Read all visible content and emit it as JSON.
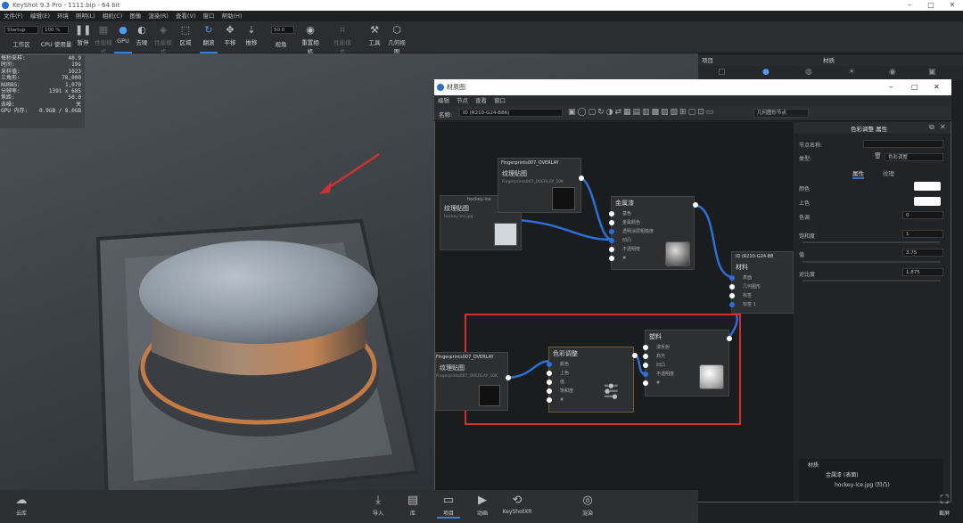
{
  "window": {
    "title": "KeyShot 9.3 Pro - 1111.bip - 64 bit"
  },
  "menubar": [
    "文件(F)",
    "编辑(E)",
    "环境",
    "照明(L)",
    "相机(C)",
    "图像",
    "渲染(R)",
    "查看(V)",
    "窗口",
    "帮助(H)"
  ],
  "toolbar": {
    "startup_value": "Startup",
    "percent_value": "100 %",
    "workspace": "工作区",
    "cpu_usage": "CPU 使用量",
    "pause": "暂停",
    "perf_mode": "性能模式",
    "gpu": "GPU",
    "denoise": "去噪",
    "region": "区域",
    "flip": "翻滚",
    "pan": "平移",
    "push": "推移",
    "fov_value": "50.0",
    "view_angle": "视角",
    "reset_camera": "重置相机",
    "tool": "工具",
    "geometry_view": "几何视图"
  },
  "stats": [
    {
      "k": "每秒采样:",
      "v": "40.9"
    },
    {
      "k": "时间:",
      "v": "19s"
    },
    {
      "k": "采样值:",
      "v": "1023"
    },
    {
      "k": "三角形:",
      "v": "78,000"
    },
    {
      "k": "NURBS:",
      "v": "1,070"
    },
    {
      "k": "分辨率:",
      "v": "1391 x 685"
    },
    {
      "k": "焦距:",
      "v": "50.0"
    },
    {
      "k": "去噪:",
      "v": "关"
    },
    {
      "k": "GPU 内存:",
      "v": "0.9GB / 8.0GB"
    }
  ],
  "right_panel": {
    "tab_project": "项目",
    "tab_material": "材质"
  },
  "material_graph": {
    "title": "材质图",
    "menu": [
      "编辑",
      "节点",
      "查看",
      "窗口"
    ],
    "name_label": "名称:",
    "name_value": "ID (R210-G24-B86)",
    "geo_node_editor": "几何图形节点",
    "nodes": {
      "tex1": {
        "head": "hockey-ice",
        "title": "纹理贴图",
        "file": "hockey-ice.jpg"
      },
      "tex2": {
        "head": "Fingerprints007_OVERLAY",
        "title": "纹理贴图",
        "file": "Fingerprints007_OVERLAY_10K"
      },
      "metal": {
        "title": "金属漆",
        "ports": [
          "基色",
          "金属颜色",
          "透明涂层粗糙度",
          "凹凸",
          "不透明度",
          "#"
        ]
      },
      "mat": {
        "head": "ID (R210-G24-B8",
        "title": "材料",
        "ports": [
          "表面",
          "几何图形",
          "标签",
          "标签 1"
        ]
      },
      "tex3": {
        "head": "Fingerprints007_OVERLAY",
        "title": "纹理贴图",
        "file": "Fingerprints007_OVERLAY_10K"
      },
      "color_adj": {
        "title": "色彩调整",
        "ports": [
          "颜色",
          "上色",
          "值",
          "饱和度",
          "#"
        ]
      },
      "plastic": {
        "title": "塑料",
        "ports": [
          "漫反射",
          "高光",
          "凹凸",
          "不透明度",
          "#"
        ]
      }
    },
    "props": {
      "title": "色彩调整 属性",
      "node_name_label": "节点名称:",
      "type_label": "类型:",
      "type_value": "色彩调整",
      "tab_props": "属性",
      "tab_texture": "纹理",
      "color_label": "颜色",
      "tint_label": "上色",
      "hue_label": "色调",
      "hue_value": "0",
      "sat_label": "饱和度",
      "sat_value": "1",
      "value_label": "值",
      "value_value": "3.75",
      "contrast_label": "对比度",
      "contrast_value": "1.875"
    },
    "tree": {
      "root": "材质",
      "child1": "金属漆 (表面)",
      "child2": "hockey-ice.jpg (凹凸)"
    }
  },
  "bottombar": {
    "cloud": "云库",
    "import": "导入",
    "library": "库",
    "project": "项目",
    "animation": "动画",
    "keyshotxr": "KeyShotXR",
    "render": "渲染",
    "screenshot": "截屏"
  },
  "colors": {
    "accent": "#2d6fd8",
    "highlight_box": "#d6302e",
    "arrow": "#d03030"
  }
}
